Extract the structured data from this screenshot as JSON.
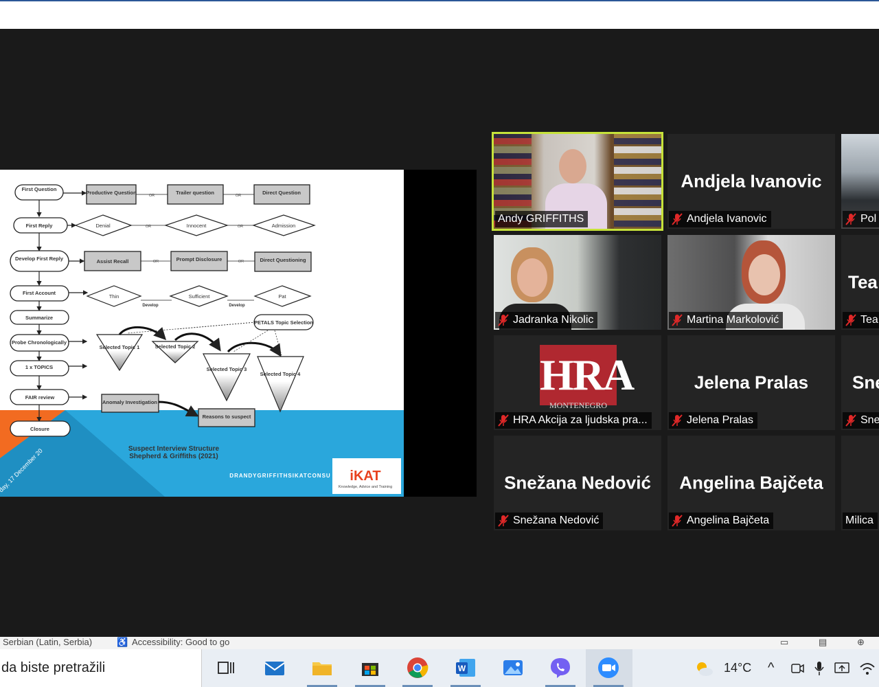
{
  "slide": {
    "flow_nodes": {
      "first_question": "First Question",
      "productive_question": "Productive Question",
      "trailer_question": "Trailer question",
      "direct_question": "Direct Question",
      "first_reply": "First Reply",
      "denial": "Denial",
      "innocent": "Innocent",
      "admission": "Admission",
      "develop_first_reply": "Develop First Reply",
      "assist_recall": "Assist Recall",
      "prompt_disclosure": "Prompt Disclosure",
      "direct_questioning": "Direct Questioning",
      "first_account": "First Account",
      "thin": "Thin",
      "sufficient": "Sufficient",
      "pat": "Pat",
      "develop": "Develop",
      "summarize": "Summarize",
      "probe_chronologically": "Probe Chronologically",
      "petals": "PETALS Topic Selection",
      "topic1": "Selected Topic 1",
      "topic2": "Selected Topic 2",
      "topic3": "Selected Topic 3",
      "topic4": "Selected Topic 4",
      "topics": "1 x TOPICS",
      "fair_review": "FAIR review",
      "anomaly": "Anomaly Investigation",
      "reasons": "Reasons to suspect",
      "closure": "Closure",
      "or": "OR"
    },
    "footer_title": "Suspect Interview Structure",
    "footer_subtitle": "Shepherd & Griffiths (2021)",
    "footer_url": "DRANDYGRIFFITHSIKATCONSU",
    "footer_date": "day, 17 December 20",
    "logo_text": "iKAT",
    "logo_tagline": "Knowledge, Advice and Training"
  },
  "participants": [
    {
      "name": "Andy GRIFFITHS",
      "video": true,
      "active": true,
      "muted": false
    },
    {
      "name": "Andjela Ivanovic",
      "display": "Andjela Ivanovic",
      "video": false,
      "muted": true
    },
    {
      "name": "Pol",
      "video": true,
      "muted": true
    },
    {
      "name": "Jadranka Nikolic",
      "video": true,
      "muted": true
    },
    {
      "name": "Martina Markolović",
      "video": true,
      "muted": true
    },
    {
      "name": "Tea",
      "display": "Tea",
      "video": false,
      "muted": true
    },
    {
      "name": "HRA Akcija za ljudska pra...",
      "video": true,
      "muted": true,
      "logo": "HRA",
      "logo_sub": "MONTENEGRO"
    },
    {
      "name": "Jelena Pralas",
      "display": "Jelena Pralas",
      "video": false,
      "muted": true
    },
    {
      "name": "Sne",
      "display": "Sne",
      "video": false,
      "muted": true
    },
    {
      "name": "Snežana Nedović",
      "display": "Snežana Nedović",
      "video": false,
      "muted": true
    },
    {
      "name": "Angelina Bajčeta",
      "display": "Angelina Bajčeta",
      "video": false,
      "muted": true
    },
    {
      "name": "Milica",
      "video": false,
      "muted": false
    }
  ],
  "statusbar": {
    "language": "Serbian (Latin, Serbia)",
    "accessibility": "Accessibility: Good to go"
  },
  "taskbar": {
    "search_text": "da biste pretražili",
    "temperature": "14°C",
    "apps": [
      "task-view",
      "mail",
      "file-explorer",
      "microsoft-store",
      "chrome",
      "word",
      "photos",
      "viber",
      "zoom"
    ]
  },
  "colors": {
    "active_speaker": "#c6e23a",
    "slide_blue": "#2aa7dc",
    "slide_orange": "#f26b21",
    "muted_red": "#e02828"
  }
}
